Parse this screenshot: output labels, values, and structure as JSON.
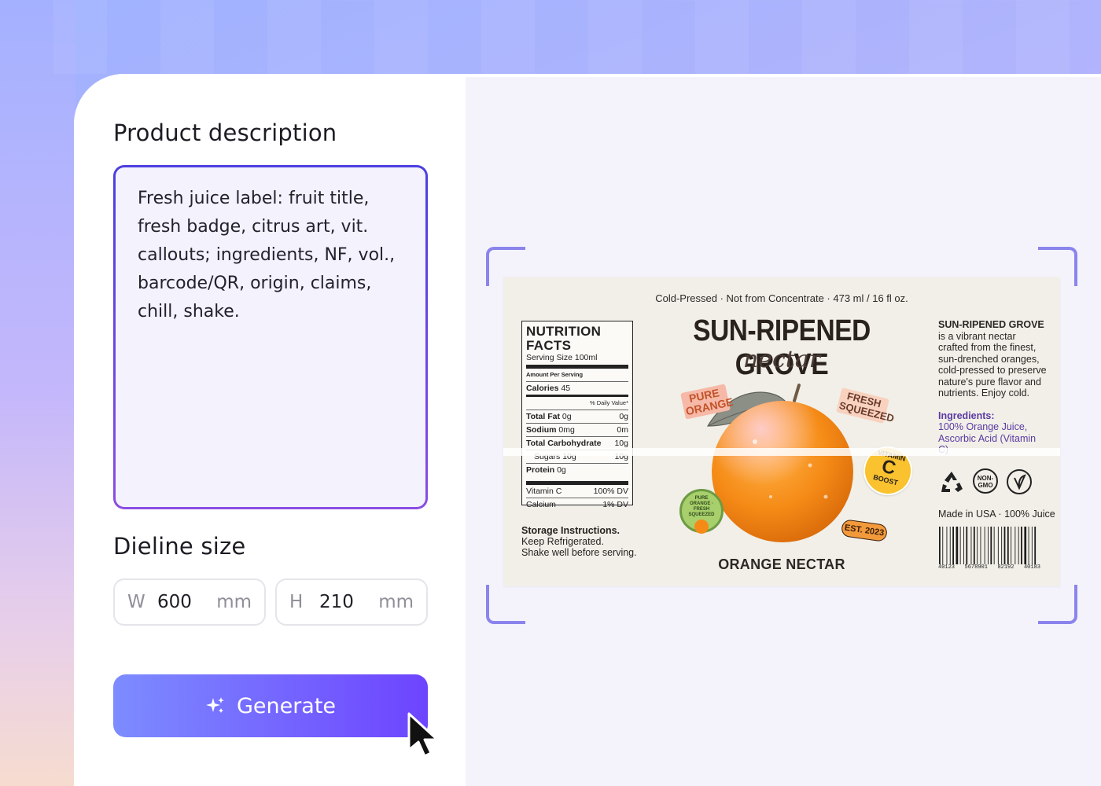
{
  "form": {
    "description_heading": "Product description",
    "description_text": "Fresh juice label: fruit title, fresh badge, citrus art, vit. callouts; ingredients, NF, vol., barcode/QR, origin, claims, chill, shake.",
    "dieline_heading": "Dieline size",
    "width_prefix": "W",
    "width_value": "600",
    "width_unit": "mm",
    "height_prefix": "H",
    "height_value": "210",
    "height_unit": "mm",
    "generate_label": "Generate"
  },
  "label": {
    "topline": "Cold-Pressed · Not from Concentrate · 473 ml / 16 fl oz.",
    "brand": "SUN-RIPENED GROVE",
    "subbrand": "nectar",
    "product_name": "ORANGE NECTAR",
    "nutrition": {
      "title": "NUTRITION FACTS",
      "serving": "Serving Size 100ml",
      "amount_per": "Amount Per Serving",
      "calories_label": "Calories",
      "calories_value": "45",
      "dv_header": "% Daily Value*",
      "rows": [
        {
          "name": "Total Fat",
          "amount": "0g",
          "dv": "0g"
        },
        {
          "name": "Sodium",
          "amount": "0mg",
          "dv": "0m"
        },
        {
          "name": "Total Carbohydrate",
          "amount": "",
          "dv": "10g"
        },
        {
          "name": "Sugars",
          "amount": "10g",
          "dv": "10g"
        },
        {
          "name": "Protein",
          "amount": "0g",
          "dv": ""
        }
      ],
      "vitamin_c_label": "Vitamin C",
      "vitamin_c_value": "100% DV",
      "calcium_label": "Calcium",
      "calcium_value": "1% DV"
    },
    "storage_title": "Storage Instructions.",
    "storage_line1": "Keep Refrigerated.",
    "storage_line2": "Shake well before serving.",
    "side_brand": "SUN-RIPENED GROVE",
    "side_text": "is a vibrant nectar crafted from the finest, sun-drenched oranges, cold-pressed to preserve nature's pure flavor and nutrients. Enjoy cold.",
    "ingredients_title": "Ingredients:",
    "ingredients_text": "100% Orange Juice, Ascorbic Acid (Vitamin C)",
    "made_in": "Made in USA · 100% Juice",
    "barcode_digits": [
      "40123",
      "5678901",
      "82192",
      "40183"
    ],
    "badges": {
      "pure_orange": "PURE ORANGE",
      "fresh_squeezed": "FRESH SQUEEZED",
      "vitamin": "VITAMIN",
      "vitamin_letter": "C",
      "boost": "BOOST",
      "est": "EST. 2023",
      "round_badge": "PURE ORANGE · FRESH SQUEEZED",
      "non_gmo": "NON-GMO"
    }
  },
  "colors": {
    "accent_start": "#7d8cff",
    "accent_end": "#6d44ff",
    "textarea_border": "#6a46e2",
    "frame_corner": "#8b84ec",
    "orange": "#f28a1c"
  }
}
